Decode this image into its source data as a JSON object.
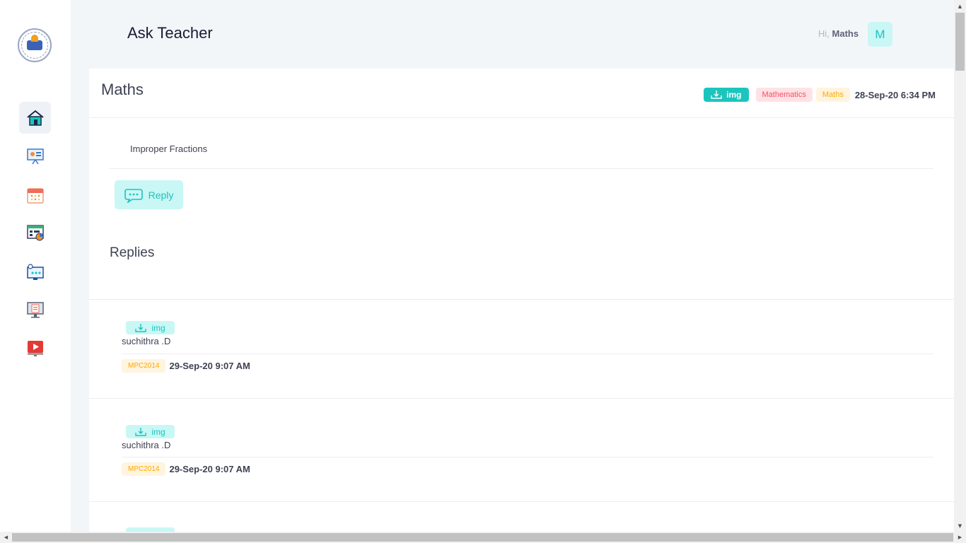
{
  "header": {
    "title": "Ask Teacher",
    "greeting_prefix": "Hi,",
    "user_name": "Maths",
    "avatar_initial": "M"
  },
  "sidebar": {
    "items": [
      {
        "icon": "home-icon",
        "active": true
      },
      {
        "icon": "presentation-icon",
        "active": false
      },
      {
        "icon": "calendar-icon",
        "active": false
      },
      {
        "icon": "report-icon",
        "active": false
      },
      {
        "icon": "online-class-icon",
        "active": false
      },
      {
        "icon": "monitor-document-icon",
        "active": false
      },
      {
        "icon": "video-play-icon",
        "active": false
      }
    ]
  },
  "question": {
    "title": "Maths",
    "attachment_label": "img",
    "subject_tag": "Mathematics",
    "class_tag": "Maths",
    "date": "28-Sep-20 6:34 PM",
    "text": "Improper Fractions",
    "reply_label": "Reply"
  },
  "replies_title": "Replies",
  "replies": [
    {
      "attachment_label": "img",
      "author": "suchithra .D",
      "tag": "MPC2014",
      "date": "29-Sep-20 9:07 AM"
    },
    {
      "attachment_label": "img",
      "author": "suchithra .D",
      "tag": "MPC2014",
      "date": "29-Sep-20 9:07 AM"
    }
  ],
  "colors": {
    "accent": "#1bc5bd",
    "accent_light": "#c9f7f5",
    "danger_light": "#ffe2e5",
    "warning_light": "#fff4de"
  }
}
